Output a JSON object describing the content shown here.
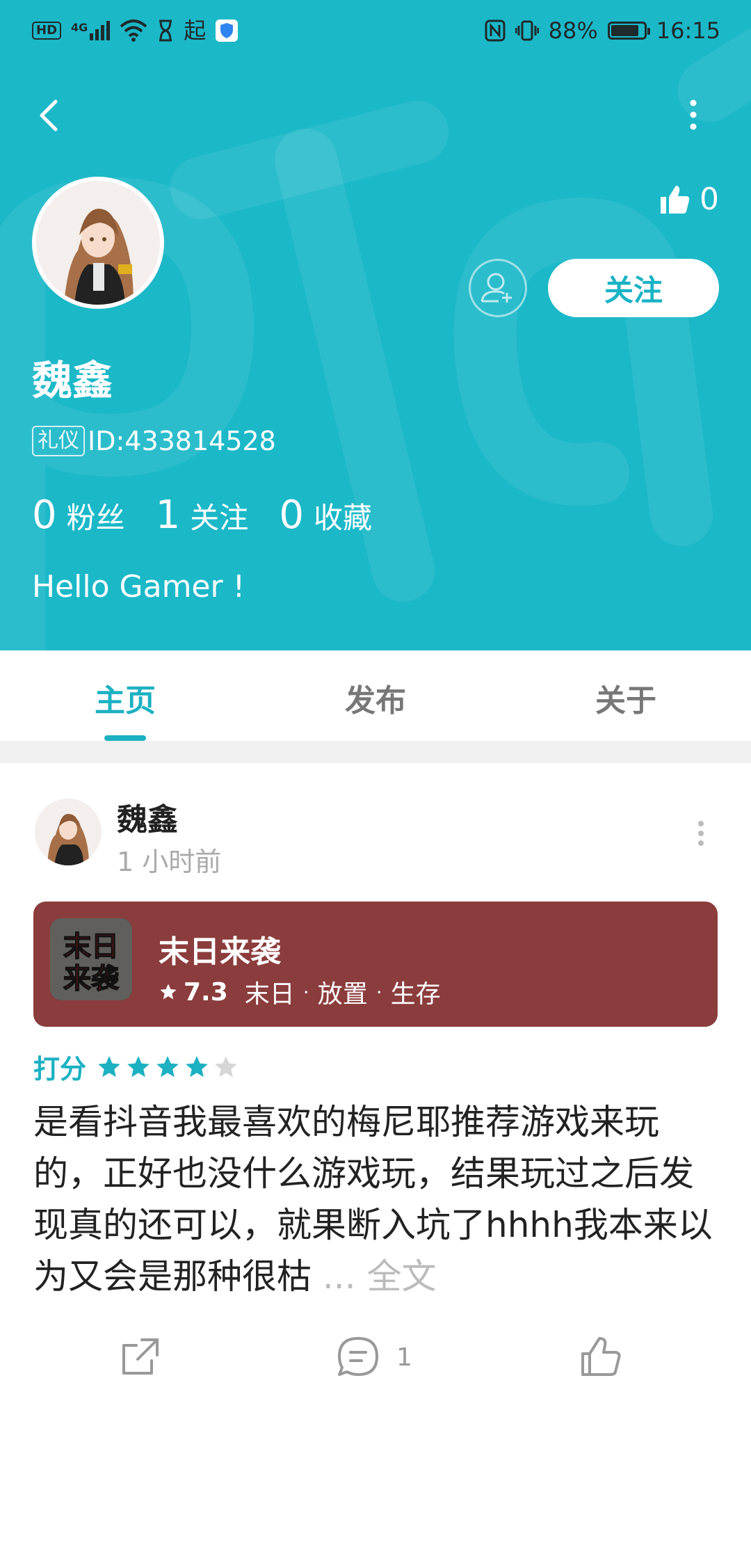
{
  "status_bar": {
    "left_chip": "HD",
    "net_label": "4G",
    "app_glyph": "起",
    "battery_text": "88%",
    "battery_level": 0.88,
    "time": "16:15"
  },
  "profile": {
    "username": "魏鑫",
    "badge": "礼仪",
    "id_text": "ID:433814528",
    "like_count": "0",
    "follow_button": "关注",
    "stats": [
      {
        "num": "0",
        "label": "粉丝"
      },
      {
        "num": "1",
        "label": "关注"
      },
      {
        "num": "0",
        "label": "收藏"
      }
    ],
    "bio": "Hello Gamer !"
  },
  "tabs": [
    {
      "label": "主页",
      "active": true
    },
    {
      "label": "发布",
      "active": false
    },
    {
      "label": "关于",
      "active": false
    }
  ],
  "post": {
    "author": "魏鑫",
    "time": "1 小时前",
    "game": {
      "icon_text_line1": "末日",
      "icon_text_line2": "来袭",
      "title": "末日来袭",
      "score": "7.3",
      "tags": [
        "末日",
        "放置",
        "生存"
      ]
    },
    "rating_label": "打分",
    "rating_stars": 4,
    "rating_max": 5,
    "body": "是看抖音我最喜欢的梅尼耶推荐游戏来玩的，正好也没什么游戏玩，结果玩过之后发现真的还可以，就果断入坑了hhhh我本来以为又会是那种很枯",
    "more_label": "... 全文",
    "comment_count": "1"
  },
  "colors": {
    "header_bg": "#1bb8c8",
    "accent": "#1bb1c2",
    "game_card_bg": "#8b3c3c"
  }
}
